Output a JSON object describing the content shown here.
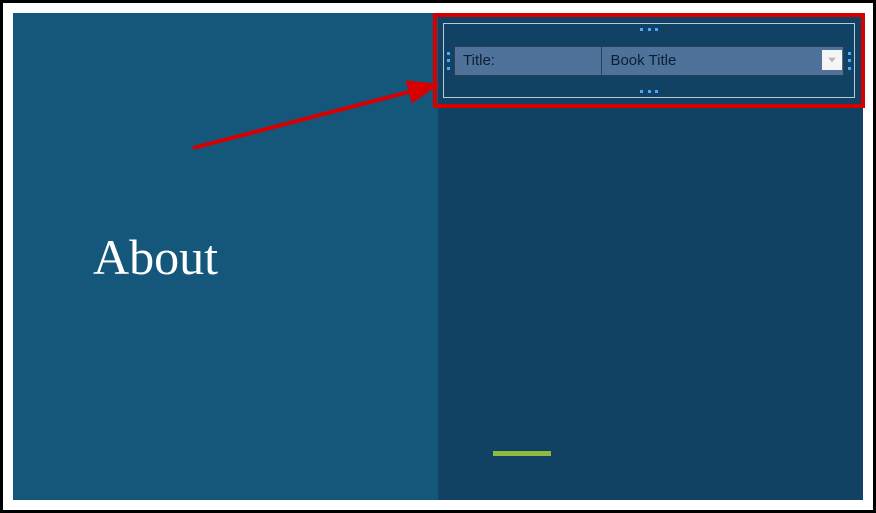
{
  "leftPanel": {
    "heading": "About"
  },
  "table": {
    "cells": {
      "label": "Title:",
      "value": "Book Title"
    }
  },
  "colors": {
    "leftBg": "#15567b",
    "rightBg": "#124263",
    "accent": "#8fba3d",
    "highlight": "#d60000",
    "arrow": "#d60000"
  }
}
